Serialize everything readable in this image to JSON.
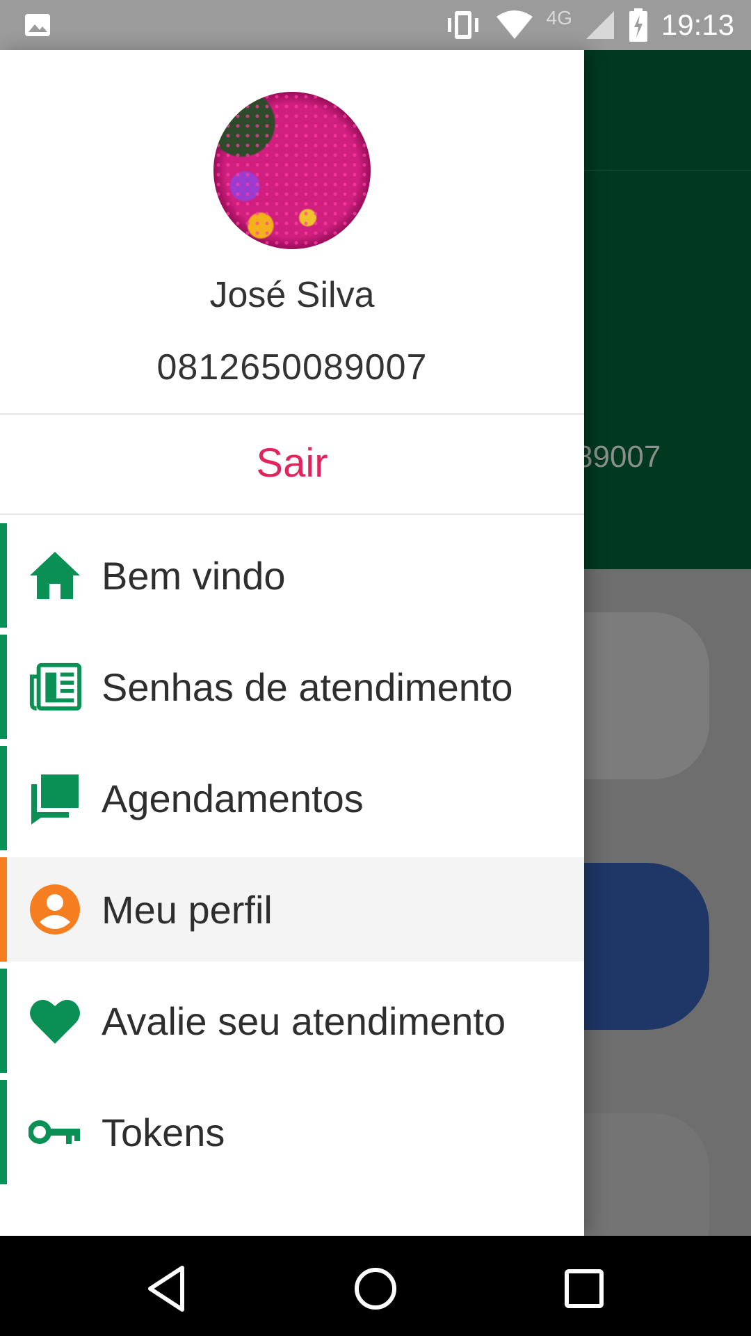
{
  "status_bar": {
    "time": "19:13",
    "network": "4G",
    "icons": [
      "image-icon",
      "vibrate-icon",
      "wifi-icon",
      "signal-icon",
      "battery-charging-icon"
    ]
  },
  "background": {
    "header_text": "89007",
    "colors": {
      "toolbar": "#003820",
      "card_primary": "#1f3766"
    }
  },
  "drawer": {
    "user": {
      "name": "José Silva",
      "phone": "0812650089007"
    },
    "logout_label": "Sair",
    "menu": [
      {
        "label": "Bem vindo",
        "icon": "home-icon",
        "active": false
      },
      {
        "label": "Senhas de atendimento",
        "icon": "newspaper-icon",
        "active": false
      },
      {
        "label": "Agendamentos",
        "icon": "chat-icon",
        "active": false
      },
      {
        "label": "Meu perfil",
        "icon": "account-circle-icon",
        "active": true
      },
      {
        "label": "Avalie seu atendimento",
        "icon": "heart-icon",
        "active": false
      },
      {
        "label": "Tokens",
        "icon": "key-icon",
        "active": false
      }
    ],
    "colors": {
      "accent": "#0a8f55",
      "active": "#f57f20",
      "logout": "#e0245e"
    }
  },
  "nav_bar": {
    "buttons": [
      "back-icon",
      "home-circle-icon",
      "recents-icon"
    ]
  }
}
